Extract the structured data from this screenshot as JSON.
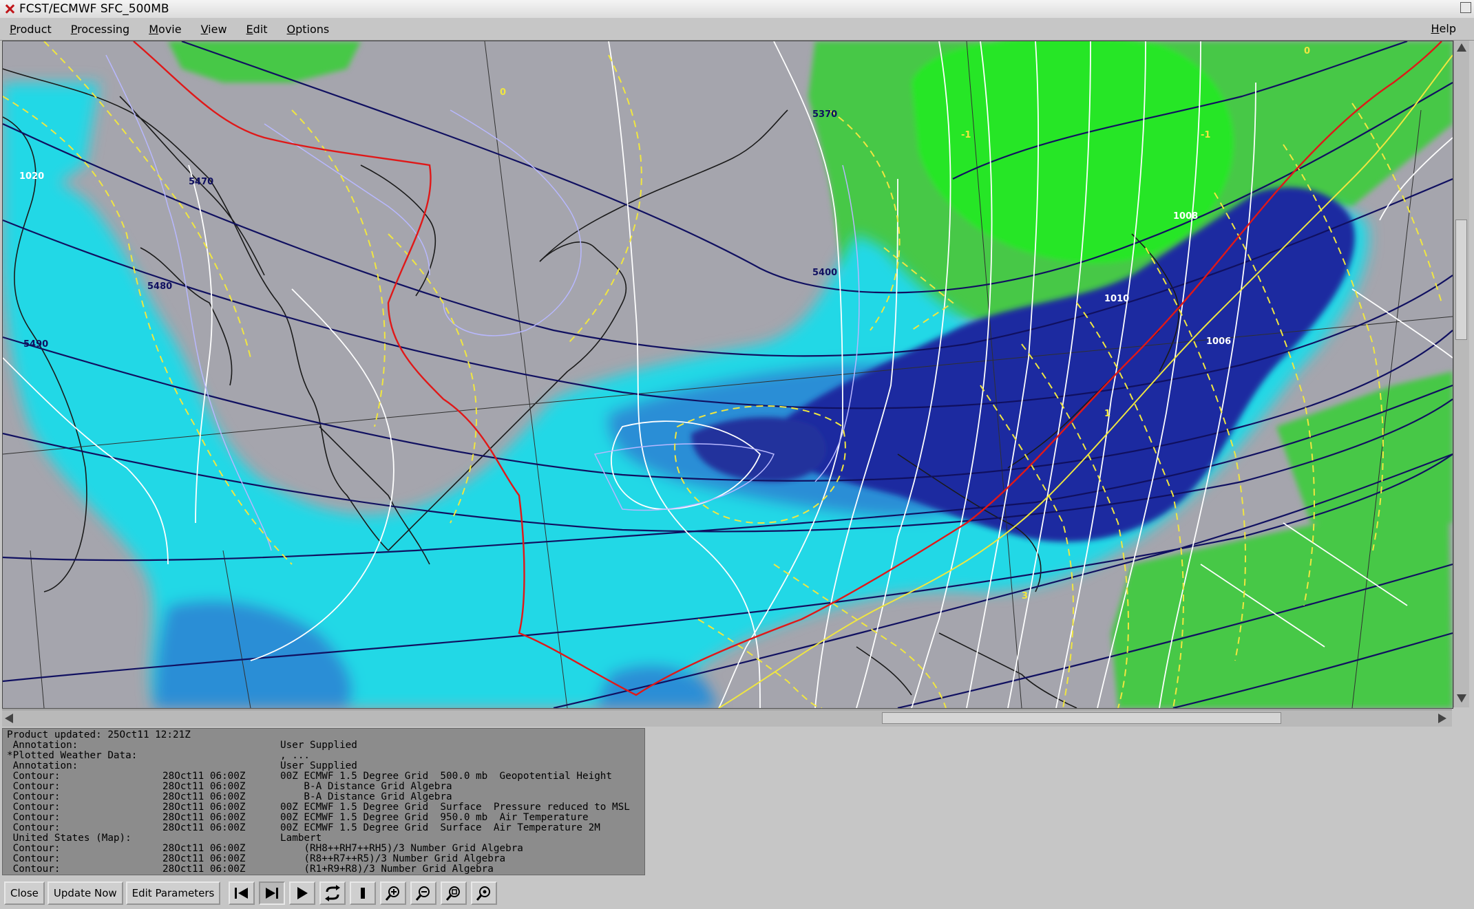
{
  "window": {
    "title": "FCST/ECMWF SFC_500MB"
  },
  "menu": {
    "items": [
      {
        "first": "P",
        "rest": "roduct"
      },
      {
        "first": "P",
        "rest": "rocessing"
      },
      {
        "first": "M",
        "rest": "ovie"
      },
      {
        "first": "V",
        "rest": "iew"
      },
      {
        "first": "E",
        "rest": "dit"
      },
      {
        "first": "O",
        "rest": "ptions"
      }
    ],
    "help": {
      "first": "H",
      "rest": "elp"
    }
  },
  "map": {
    "contour_labels": {
      "l1020": "1020",
      "l5470": "5470",
      "l5480": "5480",
      "l5490": "5490",
      "l5370": "5370",
      "l5400": "5400",
      "l1008": "1008",
      "l1010": "1010",
      "l1006": "1006",
      "lm1a": "-1",
      "lm1b": "-1",
      "l0a": "0",
      "l0b": "0",
      "l1": "1",
      "l3": "3"
    },
    "colors": {
      "background": "#a5a5ad",
      "rh_cyan": "#22d8e6",
      "rh_blue": "#2a8ed6",
      "rh_navy": "#1c2aa0",
      "precip_green": "#46c846",
      "precip_bright": "#28e628",
      "geopotential": "#101060",
      "temperature_950": "#f0e640",
      "pressure": "#ffffff",
      "freezing_line": "#e01818"
    }
  },
  "status": {
    "product_updated": "Product updated: 25Oct11 12:21Z",
    "rows": [
      {
        "c1": " Annotation:",
        "c2": "",
        "c3": "User Supplied"
      },
      {
        "c1": "*Plotted Weather Data:",
        "c2": "",
        "c3": ", ..."
      },
      {
        "c1": " Annotation:",
        "c2": "",
        "c3": "User Supplied"
      },
      {
        "c1": " Contour:",
        "c2": "28Oct11 06:00Z",
        "c3": "00Z ECMWF 1.5 Degree Grid  500.0 mb  Geopotential Height"
      },
      {
        "c1": " Contour:",
        "c2": "28Oct11 06:00Z",
        "c3": "    B-A Distance Grid Algebra"
      },
      {
        "c1": " Contour:",
        "c2": "28Oct11 06:00Z",
        "c3": "    B-A Distance Grid Algebra"
      },
      {
        "c1": " Contour:",
        "c2": "28Oct11 06:00Z",
        "c3": "00Z ECMWF 1.5 Degree Grid  Surface  Pressure reduced to MSL"
      },
      {
        "c1": " Contour:",
        "c2": "28Oct11 06:00Z",
        "c3": "00Z ECMWF 1.5 Degree Grid  950.0 mb  Air Temperature"
      },
      {
        "c1": " Contour:",
        "c2": "28Oct11 06:00Z",
        "c3": "00Z ECMWF 1.5 Degree Grid  Surface  Air Temperature 2M"
      },
      {
        "c1": " United States (Map):",
        "c2": "",
        "c3": "Lambert"
      },
      {
        "c1": " Contour:",
        "c2": "28Oct11 06:00Z",
        "c3": "    (RH8++RH7++RH5)/3 Number Grid Algebra"
      },
      {
        "c1": " Contour:",
        "c2": "28Oct11 06:00Z",
        "c3": "    (R8++R7++R5)/3 Number Grid Algebra"
      },
      {
        "c1": " Contour:",
        "c2": "28Oct11 06:00Z",
        "c3": "    (R1+R9+R8)/3 Number Grid Algebra"
      }
    ]
  },
  "toolbar": {
    "close_label": "Close",
    "update_label": "Update Now",
    "edit_params_label": "Edit Parameters"
  }
}
